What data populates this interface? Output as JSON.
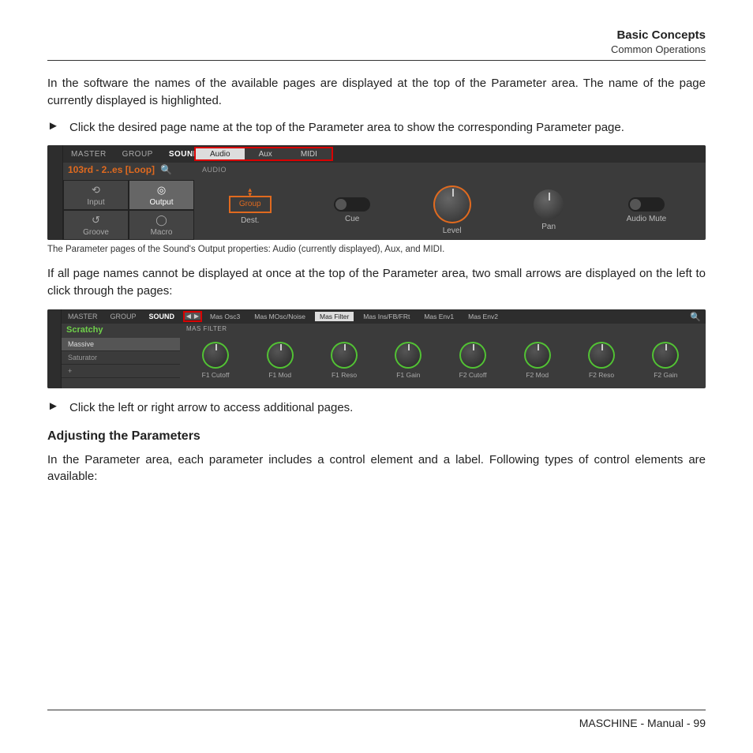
{
  "header": {
    "section": "Basic Concepts",
    "subsection": "Common Operations"
  },
  "paragraphs": {
    "p1": "In the software the names of the available pages are displayed at the top of the Parameter area. The name of the page currently displayed is highlighted.",
    "bullet1": "Click the desired page name at the top of the Parameter area to show the corresponding Parameter page.",
    "caption1": "The Parameter pages of the Sound's Output properties: Audio (currently displayed), Aux, and MIDI.",
    "p2": "If all page names cannot be displayed at once at the top of the Parameter area, two small arrows are displayed on the left to click through the pages:",
    "bullet2": "Click the left or right arrow to access additional pages.",
    "h3": "Adjusting the Parameters",
    "p3": "In the Parameter area, each parameter includes a control element and a label. Following types of control elements are available:"
  },
  "shot1": {
    "scope": {
      "master": "MASTER",
      "group": "GROUP",
      "sound": "SOUND"
    },
    "tabs": {
      "audio": "Audio",
      "aux": "Aux",
      "midi": "MIDI"
    },
    "sound_name": "103rd - 2..es [Loop]",
    "section_label": "AUDIO",
    "props": {
      "input": "Input",
      "output": "Output",
      "groove": "Groove",
      "macro": "Macro"
    },
    "params": {
      "dest_value": "Group",
      "dest": "Dest.",
      "cue": "Cue",
      "level": "Level",
      "pan": "Pan",
      "mute": "Audio Mute"
    }
  },
  "shot2": {
    "scope": {
      "master": "MASTER",
      "group": "GROUP",
      "sound": "SOUND"
    },
    "sound_name": "Scratchy",
    "plugins": {
      "p1": "Massive",
      "p2": "Saturator",
      "p3": "+"
    },
    "tabs": [
      "Mas Osc3",
      "Mas MOsc/Noise",
      "Mas Filter",
      "Mas Ins/FB/FRt",
      "Mas Env1",
      "Mas Env2"
    ],
    "active_tab_index": 2,
    "sub_label": "MAS FILTER",
    "knobs": [
      "F1 Cutoff",
      "F1 Mod",
      "F1 Reso",
      "F1 Gain",
      "F2 Cutoff",
      "F2 Mod",
      "F2 Reso",
      "F2 Gain"
    ]
  },
  "footer": {
    "text": "MASCHINE - Manual - 99"
  }
}
